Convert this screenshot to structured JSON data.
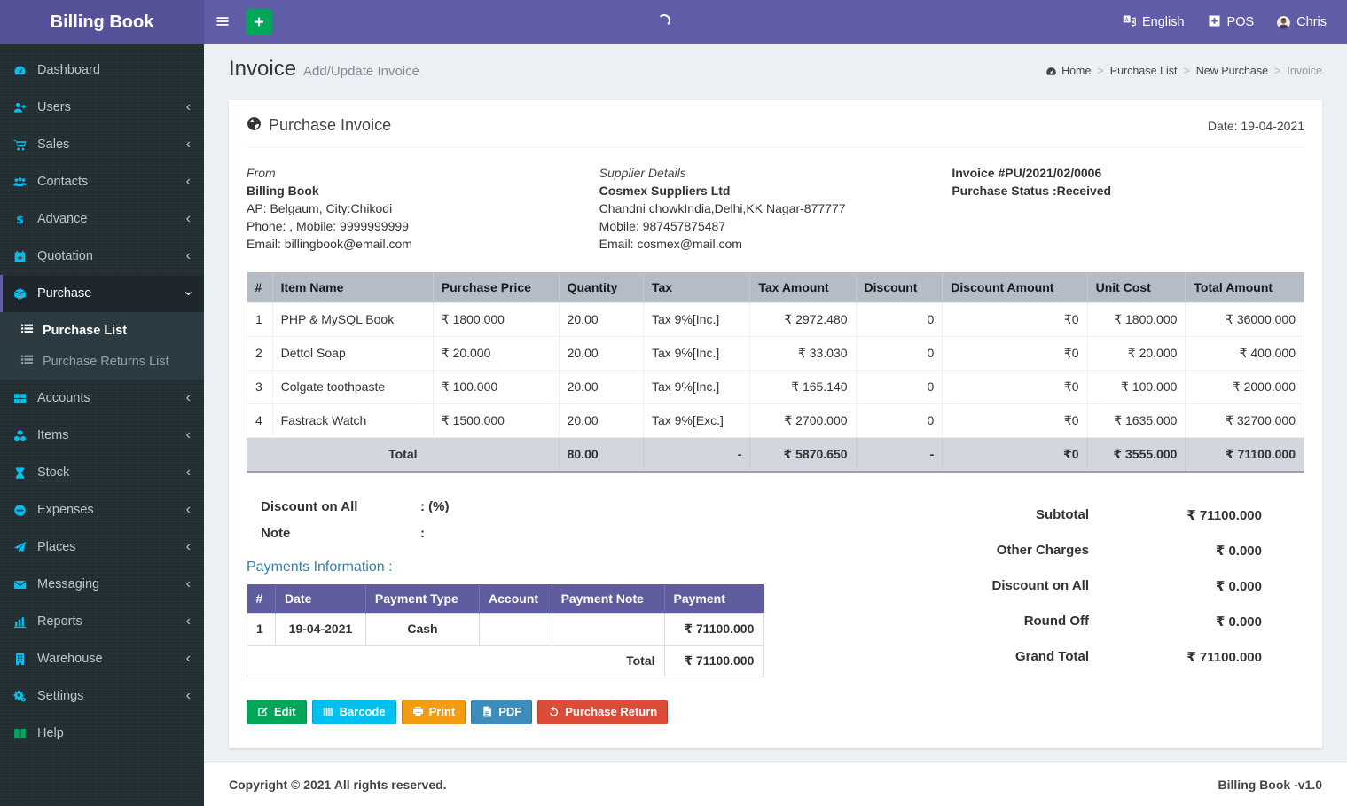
{
  "app": {
    "title": "Billing Book",
    "version_label": "Billing Book -v1.0",
    "copyright": "Copyright © 2021 All rights reserved."
  },
  "navbar": {
    "language_label": "English",
    "pos_label": "POS",
    "user_name": "Chris"
  },
  "sidebar": {
    "items": [
      {
        "label": "Dashboard",
        "icon": "gauge",
        "chevron": false
      },
      {
        "label": "Users",
        "icon": "user-plus",
        "chevron": true
      },
      {
        "label": "Sales",
        "icon": "cart",
        "chevron": true
      },
      {
        "label": "Contacts",
        "icon": "users",
        "chevron": true
      },
      {
        "label": "Advance",
        "icon": "dollar",
        "chevron": true
      },
      {
        "label": "Quotation",
        "icon": "calendar-plus",
        "chevron": true
      },
      {
        "label": "Purchase",
        "icon": "cube",
        "chevron": true,
        "active": true,
        "expanded": true,
        "children": [
          {
            "label": "Purchase List",
            "icon": "list",
            "active": true
          },
          {
            "label": "Purchase Returns List",
            "icon": "list",
            "active": false
          }
        ]
      },
      {
        "label": "Accounts",
        "icon": "th-large",
        "chevron": true
      },
      {
        "label": "Items",
        "icon": "cubes",
        "chevron": true
      },
      {
        "label": "Stock",
        "icon": "hourglass",
        "chevron": true
      },
      {
        "label": "Expenses",
        "icon": "minus-circle",
        "chevron": true
      },
      {
        "label": "Places",
        "icon": "paper-plane",
        "chevron": true
      },
      {
        "label": "Messaging",
        "icon": "envelope",
        "chevron": true
      },
      {
        "label": "Reports",
        "icon": "bar-chart",
        "chevron": true
      },
      {
        "label": "Warehouse",
        "icon": "building",
        "chevron": true
      },
      {
        "label": "Settings",
        "icon": "cogs",
        "chevron": true
      },
      {
        "label": "Help",
        "icon": "book",
        "chevron": false,
        "icon_color": "#00a65a"
      }
    ]
  },
  "page": {
    "title": "Invoice",
    "subtitle": "Add/Update Invoice",
    "breadcrumb": [
      "Home",
      "Purchase List",
      "New Purchase",
      "Invoice"
    ]
  },
  "invoice": {
    "heading": "Purchase Invoice",
    "date_label": "Date: 19-04-2021",
    "from": {
      "section_label": "From",
      "name": "Billing Book",
      "address": "AP: Belgaum, City:Chikodi",
      "phone": "Phone: , Mobile: 9999999999",
      "email": "Email: billingbook@email.com"
    },
    "supplier": {
      "section_label": "Supplier Details",
      "name": "Cosmex Suppliers Ltd",
      "address": "Chandni chowkIndia,Delhi,KK Nagar-877777",
      "mobile": "Mobile: 987457875487",
      "email": "Email: cosmex@mail.com"
    },
    "meta": {
      "invoice_no": "Invoice #PU/2021/02/0006",
      "status": "Purchase Status :Received"
    }
  },
  "items_table": {
    "headers": [
      "#",
      "Item Name",
      "Purchase Price",
      "Quantity",
      "Tax",
      "Tax Amount",
      "Discount",
      "Discount Amount",
      "Unit Cost",
      "Total Amount"
    ],
    "rows": [
      [
        "1",
        "PHP & MySQL Book",
        "₹ 1800.000",
        "20.00",
        "Tax 9%[Inc.]",
        "₹ 2972.480",
        "0",
        "₹0",
        "₹ 1800.000",
        "₹ 36000.000"
      ],
      [
        "2",
        "Dettol Soap",
        "₹ 20.000",
        "20.00",
        "Tax 9%[Inc.]",
        "₹ 33.030",
        "0",
        "₹0",
        "₹ 20.000",
        "₹ 400.000"
      ],
      [
        "3",
        "Colgate toothpaste",
        "₹ 100.000",
        "20.00",
        "Tax 9%[Inc.]",
        "₹ 165.140",
        "0",
        "₹0",
        "₹ 100.000",
        "₹ 2000.000"
      ],
      [
        "4",
        "Fastrack Watch",
        "₹ 1500.000",
        "20.00",
        "Tax 9%[Exc.]",
        "₹ 2700.000",
        "0",
        "₹0",
        "₹ 1635.000",
        "₹ 32700.000"
      ]
    ],
    "total_row": [
      "Total",
      "80.00",
      "-",
      "₹ 5870.650",
      "-",
      "₹0",
      "₹ 3555.000",
      "₹ 71100.000"
    ]
  },
  "discount_note": {
    "discount_label": "Discount on All",
    "discount_value": ": (%)",
    "note_label": "Note",
    "note_value": ":"
  },
  "payments": {
    "heading": "Payments Information :",
    "headers": [
      "#",
      "Date",
      "Payment Type",
      "Account",
      "Payment Note",
      "Payment"
    ],
    "rows": [
      [
        "1",
        "19-04-2021",
        "Cash",
        "",
        "",
        "₹ 71100.000"
      ]
    ],
    "total_label": "Total",
    "total_value": "₹ 71100.000"
  },
  "summary": {
    "rows": [
      {
        "label": "Subtotal",
        "value": "₹ 71100.000"
      },
      {
        "label": "Other Charges",
        "value": "₹ 0.000"
      },
      {
        "label": "Discount on All",
        "value": "₹ 0.000"
      },
      {
        "label": "Round Off",
        "value": "₹ 0.000"
      },
      {
        "label": "Grand Total",
        "value": "₹ 71100.000"
      }
    ]
  },
  "actions": [
    {
      "label": "Edit",
      "icon": "edit",
      "color": "#00a65a"
    },
    {
      "label": "Barcode",
      "icon": "barcode",
      "color": "#00c0ef"
    },
    {
      "label": "Print",
      "icon": "print",
      "color": "#f39c12"
    },
    {
      "label": "PDF",
      "icon": "pdf",
      "color": "#3c8dbc"
    },
    {
      "label": "Purchase Return",
      "icon": "undo",
      "color": "#dd4b39"
    }
  ],
  "colors": {
    "navbar": "#605ca8",
    "logo_bg": "#555299",
    "sidebar_bg": "#222d32",
    "sidebar_icon": "#00c0ef",
    "table_header_bg": "#b5bcc6",
    "table_total_bg": "#d2d6de",
    "payments_header_bg": "#5f5d9e",
    "payments_heading_text": "#367fa9"
  }
}
